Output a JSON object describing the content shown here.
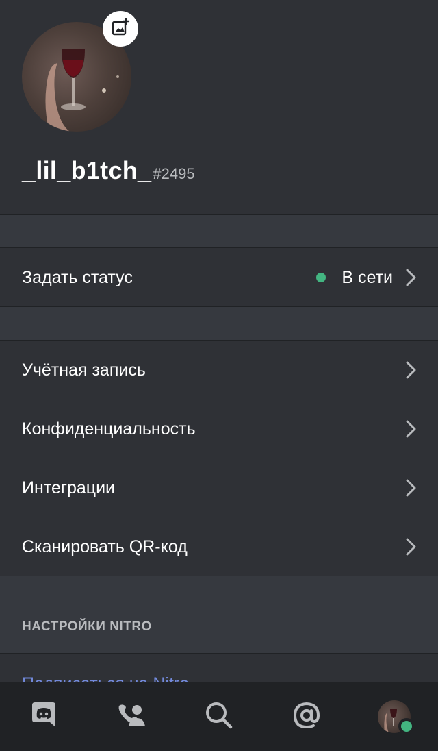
{
  "profile": {
    "username": "_lil_b1tch_",
    "discriminator": "#2495"
  },
  "status_row": {
    "label": "Задать статус",
    "value": "В сети",
    "dot_color": "#43b581"
  },
  "settings": [
    {
      "label": "Учётная запись"
    },
    {
      "label": "Конфиденциальность"
    },
    {
      "label": "Интеграции"
    },
    {
      "label": "Сканировать QR-код"
    }
  ],
  "nitro": {
    "header": "НАСТРОЙКИ NITRO",
    "first_item": "Подписаться на Nitro"
  },
  "tabbar": {
    "tabs": [
      "discord-home-icon",
      "friends-icon",
      "search-icon",
      "mentions-icon",
      "profile-avatar"
    ]
  },
  "colors": {
    "accent": "#7289da",
    "online": "#43b581"
  }
}
